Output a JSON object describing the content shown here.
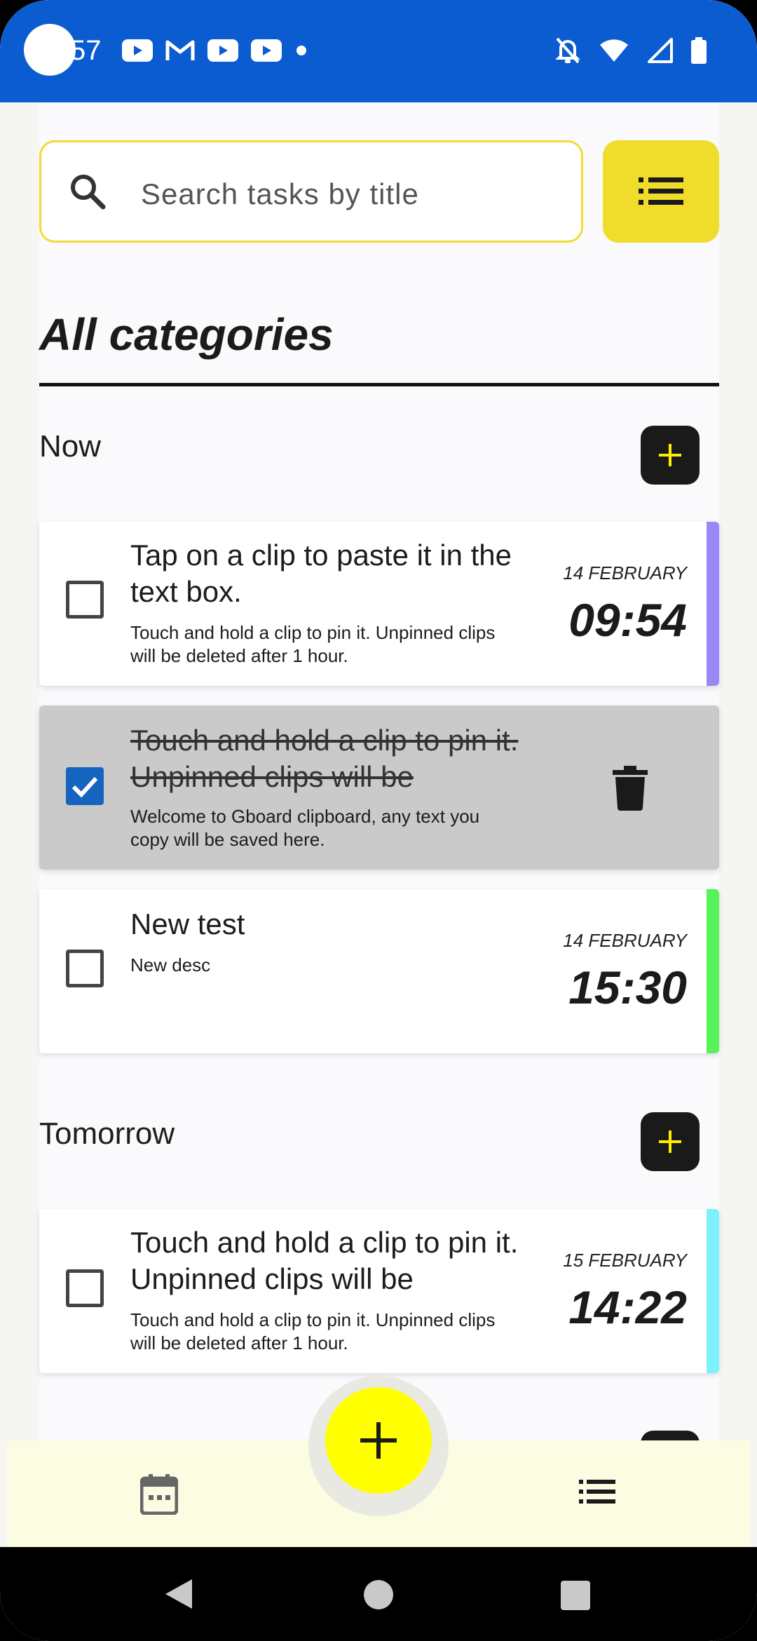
{
  "status_bar": {
    "time": "57",
    "icons_left": [
      "youtube-icon",
      "gmail-icon",
      "youtube-icon",
      "youtube-icon",
      "dot-icon"
    ],
    "icons_right": [
      "bell-off-icon",
      "wifi-icon",
      "signal-icon",
      "battery-icon"
    ]
  },
  "search": {
    "placeholder": "Search tasks by title"
  },
  "page_title": "All categories",
  "sections": [
    {
      "label": "Now"
    },
    {
      "label": "Tomorrow"
    }
  ],
  "tasks": [
    {
      "title": "Tap on a clip to paste it in the text box.",
      "description": "Touch and hold a clip to pin it. Unpinned clips will be deleted after 1 hour.",
      "date": "14 FEBRUARY",
      "time": "09:54",
      "checked": false,
      "accent": "#9b86f5"
    },
    {
      "title": "Touch and hold a clip to pin it. Unpinned clips will be",
      "description": "Welcome to Gboard clipboard, any text you copy will be saved here.",
      "checked": true
    },
    {
      "title": "New test",
      "description": "New desc",
      "date": "14 FEBRUARY",
      "time": "15:30",
      "checked": false,
      "accent": "#55f25a"
    },
    {
      "title": "Touch and hold a clip to pin it. Unpinned clips will be",
      "description": "Touch and hold a clip to pin it. Unpinned clips will be deleted after 1 hour.",
      "date": "15 FEBRUARY",
      "time": "14:22",
      "checked": false,
      "accent": "#7cf0fb"
    }
  ],
  "colors": {
    "status_bar": "#0b5cd0",
    "search_border": "#f1dc34",
    "toggle": "#f0dd2b",
    "fab": "#ffff00",
    "checkbox_checked": "#1565c0",
    "bottom_nav": "#fcfce2"
  },
  "bottom_nav": {
    "left_icon": "calendar-icon",
    "right_icon": "list-icon",
    "fab_icon": "plus-icon"
  }
}
